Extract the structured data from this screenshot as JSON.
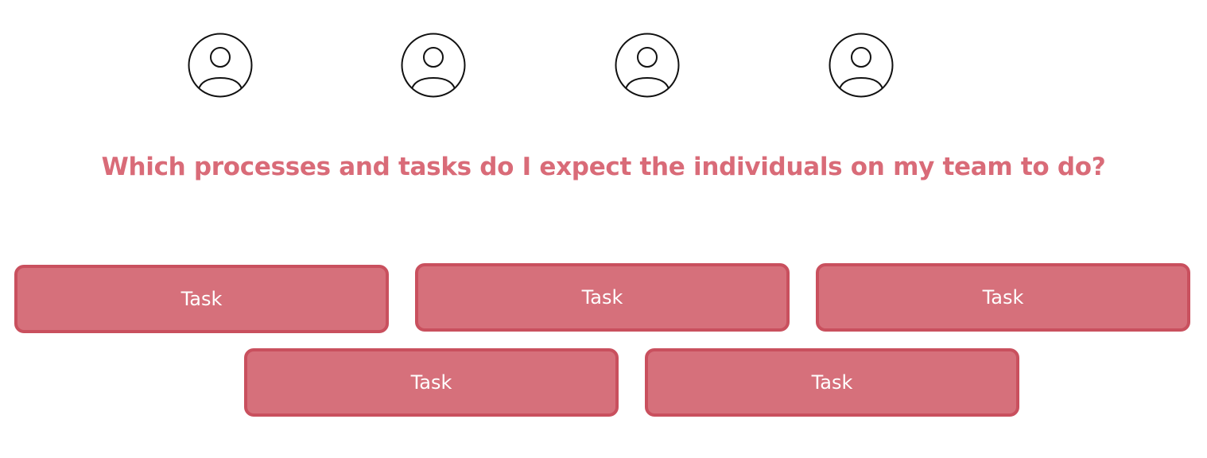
{
  "headline": "Which processes and tasks do I expect the individuals on my team to do?",
  "avatars": [
    {
      "icon": "person-icon"
    },
    {
      "icon": "person-icon"
    },
    {
      "icon": "person-icon"
    },
    {
      "icon": "person-icon"
    }
  ],
  "tasks": [
    {
      "label": "Task"
    },
    {
      "label": "Task"
    },
    {
      "label": "Task"
    },
    {
      "label": "Task"
    },
    {
      "label": "Task"
    }
  ],
  "colors": {
    "accent": "#d96b78",
    "task_fill": "#d6707b",
    "task_border": "#c9505e",
    "icon_stroke": "#111111"
  }
}
